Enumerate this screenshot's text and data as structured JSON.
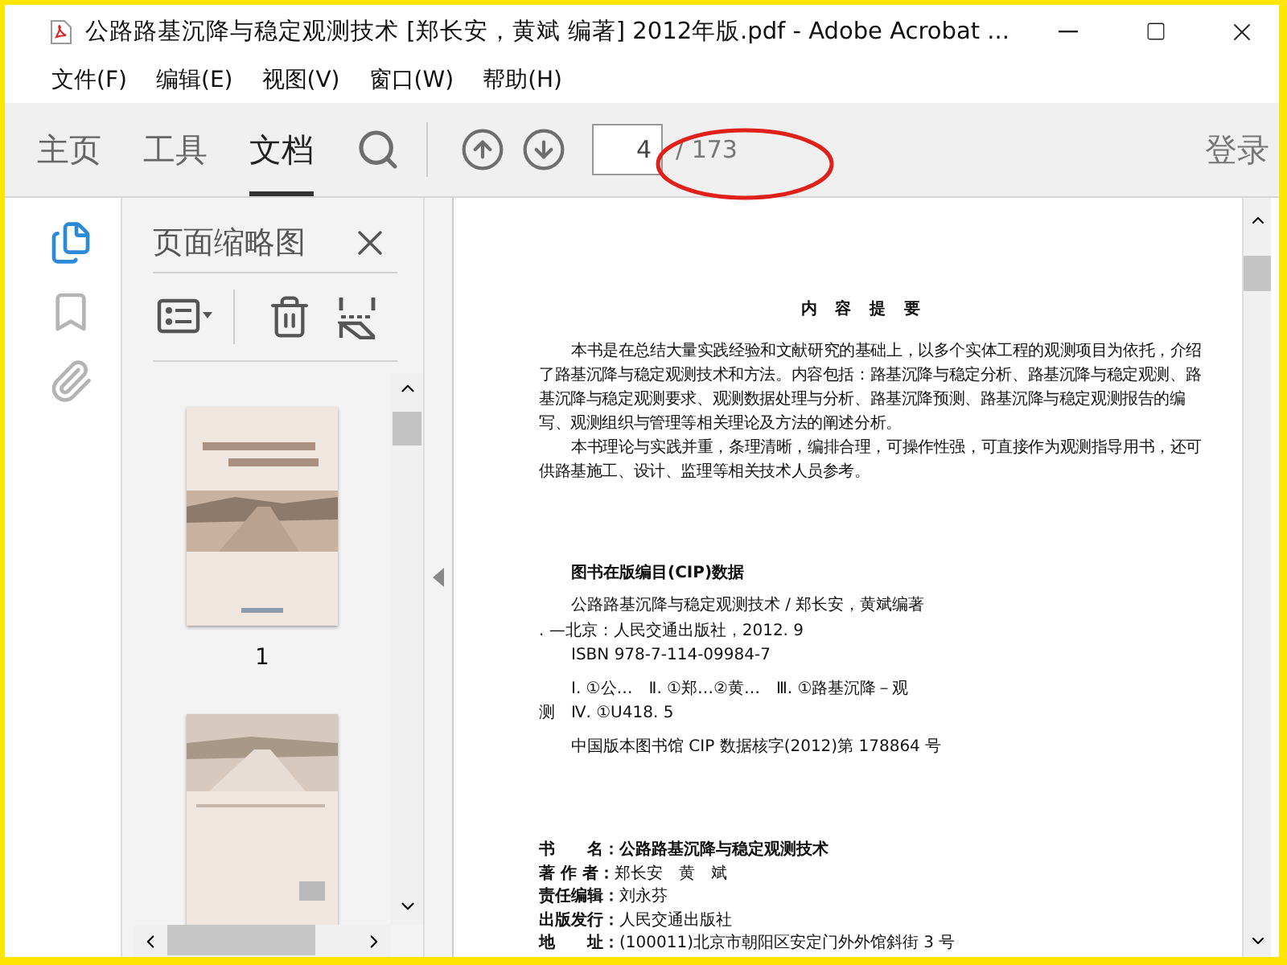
{
  "window": {
    "title": "公路路基沉降与稳定观测技术 [郑长安，黄斌 编著] 2012年版.pdf - Adobe Acrobat ..."
  },
  "menu": [
    "文件(F)",
    "编辑(E)",
    "视图(V)",
    "窗口(W)",
    "帮助(H)"
  ],
  "tabs": [
    {
      "label": "主页",
      "selected": false
    },
    {
      "label": "工具",
      "selected": false
    },
    {
      "label": "文档",
      "selected": true
    }
  ],
  "page_field": {
    "value": "4",
    "total": "/ 173"
  },
  "sign_in": "登录",
  "side_rail": [
    {
      "kind": "pages",
      "selected": true
    },
    {
      "kind": "bookmarks",
      "selected": false
    },
    {
      "kind": "attachments",
      "selected": false
    }
  ],
  "thumbnail_panel": {
    "title": "页面缩略图",
    "thumbnails": [
      {
        "kind": "picture",
        "label": "1"
      },
      {
        "kind": "picture"
      }
    ]
  },
  "document": {
    "heading": "内 容 提 要",
    "summary": [
      "本书是在总结大量实践经验和文献研究的基础上，以多个实体工程的观测项目为依托，介绍了路基沉降与稳定观测技术和方法。内容包括：路基沉降与稳定分析、路基沉降与稳定观测、路基沉降与稳定观测要求、观测数据处理与分析、路基沉降预测、路基沉降与稳定观测报告的编写、观测组织与管理等相关理论及方法的阐述分析。",
      "本书理论与实践并重，条理清晰，编排合理，可操作性强，可直接作为观测指导用书，还可供路基施工、设计、监理等相关技术人员参考。"
    ],
    "cip_title": "图书在版编目(CIP)数据",
    "cip_groups": [
      [
        {
          "text": "公路路基沉降与稳定观测技术 / 郑长安，黄斌编著",
          "kind": "indent"
        },
        {
          "text": ". —北京：人民交通出版社，2012. 9",
          "kind": "flush"
        },
        {
          "text": "ISBN 978-7-114-09984-7",
          "kind": "indent"
        }
      ],
      [
        {
          "text": "Ⅰ. ①公…　Ⅱ. ①郑…②黄…　Ⅲ. ①路基沉降－观",
          "kind": "indent"
        },
        {
          "text": "测　Ⅳ. ①U418. 5",
          "kind": "flush"
        }
      ],
      [
        {
          "text": "中国版本图书馆 CIP 数据核字(2012)第 178864 号",
          "kind": "indent"
        }
      ]
    ],
    "info_rows": [
      {
        "label": "书　　名：",
        "value": "公路路基沉降与稳定观测技术",
        "emphasis": true
      },
      {
        "label": "著 作 者：",
        "value": "郑长安　黄　斌",
        "emphasis": false
      },
      {
        "label": "责任编辑：",
        "value": "刘永芬",
        "emphasis": false
      },
      {
        "label": "出版发行：",
        "value": "人民交通出版社",
        "emphasis": false
      },
      {
        "label": "地　　址：",
        "value": "(100011)北京市朝阳区安定门外外馆斜街 3 号",
        "emphasis": false
      }
    ]
  }
}
